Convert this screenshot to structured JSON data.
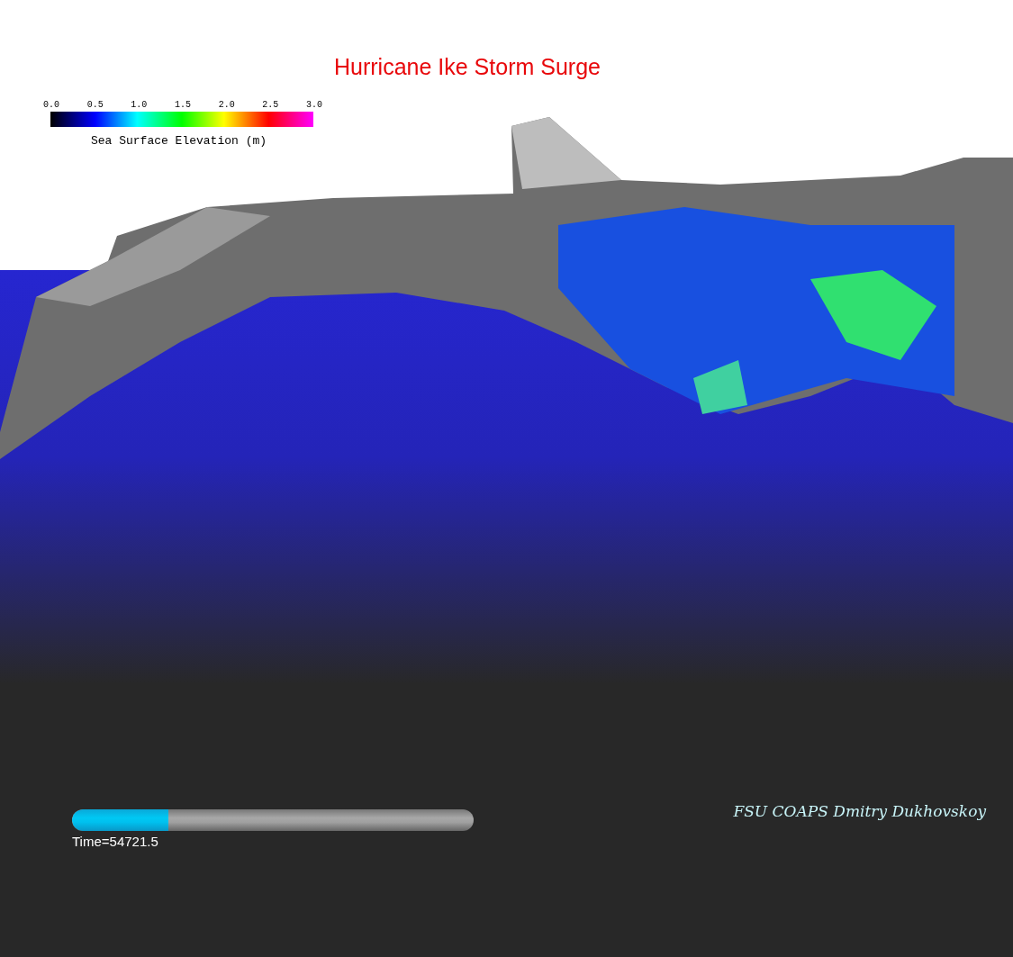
{
  "title": "Hurricane Ike Storm Surge",
  "colorbar": {
    "ticks": [
      "0.0",
      "0.5",
      "1.0",
      "1.5",
      "2.0",
      "2.5",
      "3.0"
    ],
    "label": "Sea Surface Elevation (m)"
  },
  "progress": {
    "level": 0.24,
    "caption": "Time=54721.5"
  },
  "credit": "FSU COAPS Dmitry Dukhovskoy"
}
